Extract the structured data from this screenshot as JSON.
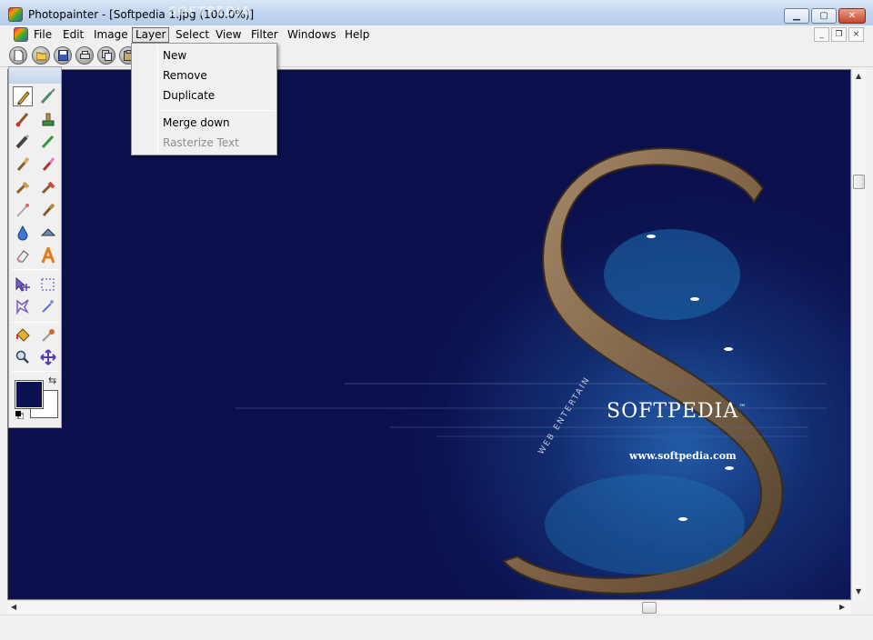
{
  "window": {
    "title": "Photopainter - [Softpedia 1.jpg  (100.0%)]",
    "watermark": "SOFTPEDIA",
    "controls": {
      "minimize": "▁",
      "maximize": "▢",
      "close": "✕"
    }
  },
  "menubar": {
    "items": [
      "File",
      "Edit",
      "Image",
      "Layer",
      "Select",
      "View",
      "Filter",
      "Windows",
      "Help"
    ],
    "active": "Layer",
    "mdi_controls": {
      "minimize": "_",
      "restore": "❐",
      "close": "×"
    }
  },
  "layer_menu": {
    "items": [
      {
        "label": "New",
        "enabled": true
      },
      {
        "label": "Remove",
        "enabled": true
      },
      {
        "label": "Duplicate",
        "enabled": true
      },
      {
        "label": "Merge down",
        "enabled": true
      },
      {
        "label": "Rasterize Text",
        "enabled": false
      }
    ]
  },
  "toolbar": {
    "buttons": [
      "new-icon",
      "open-icon",
      "save-icon",
      "print-icon",
      "copy-icon",
      "paste-icon"
    ]
  },
  "tools": [
    "pencil-icon",
    "airbrush-icon",
    "paintbrush-icon",
    "clone-stamp-icon",
    "marker-icon",
    "crayon-icon",
    "brush-icon",
    "eraser-brush-icon",
    "fill-brush-icon",
    "smudge-icon",
    "wand-brush-icon",
    "blur-icon",
    "water-drop-icon",
    "triangle-shape-icon",
    "eraser-icon",
    "text-tool-icon",
    "move-selection-icon",
    "rect-select-icon",
    "lasso-icon",
    "magic-wand-icon",
    "paint-bucket-icon",
    "eyedropper-icon",
    "zoom-icon",
    "move-icon"
  ],
  "colors": {
    "foreground": "#0b1050",
    "background": "#ffffff",
    "swap_glyph": "⇆"
  },
  "canvas": {
    "image_text": {
      "logo": "SOFTPEDIA",
      "trademark": "™",
      "url": "www.softpedia.com",
      "tagline": "WEB  ENTERTAIN"
    }
  },
  "scroll_glyphs": {
    "up": "▲",
    "down": "▼",
    "left": "◀",
    "right": "▶"
  }
}
